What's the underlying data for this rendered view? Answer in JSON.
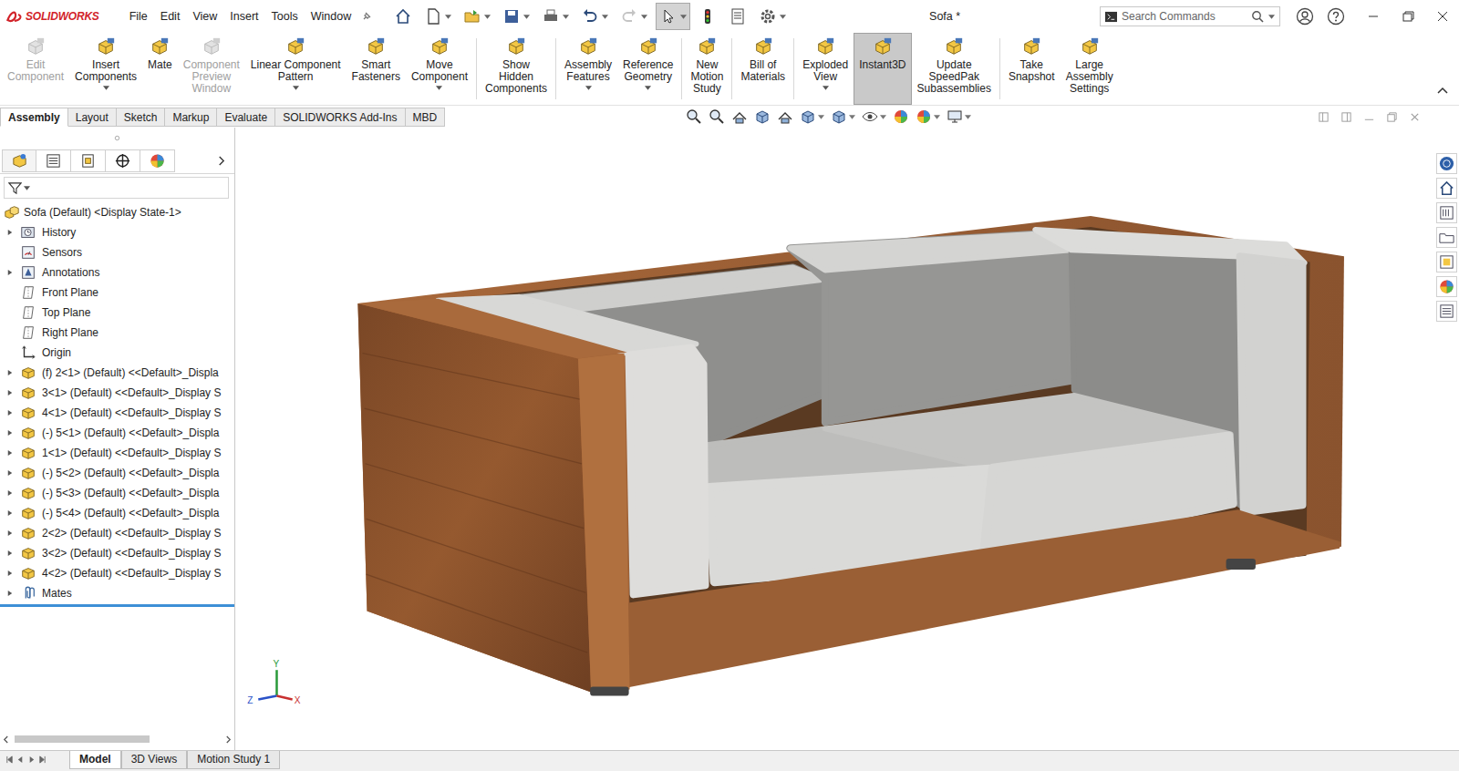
{
  "app": {
    "logo": "SOLIDWORKS",
    "title": "Sofa *"
  },
  "menu": [
    "File",
    "Edit",
    "View",
    "Insert",
    "Tools",
    "Window"
  ],
  "quick_access": {
    "select_active": true,
    "redo_disabled": true
  },
  "search": {
    "placeholder": "Search Commands"
  },
  "ribbon": {
    "groups": [
      [
        {
          "lines": [
            "Edit",
            "Component"
          ],
          "disabled": true,
          "menu": false,
          "selected": false
        },
        {
          "lines": [
            "Insert",
            "Components"
          ],
          "disabled": false,
          "menu": true,
          "selected": false
        },
        {
          "lines": [
            "Mate"
          ],
          "disabled": false,
          "menu": false,
          "selected": false
        },
        {
          "lines": [
            "Component",
            "Preview",
            "Window"
          ],
          "disabled": true,
          "menu": false,
          "selected": false
        },
        {
          "lines": [
            "Linear Component",
            "Pattern"
          ],
          "disabled": false,
          "menu": true,
          "selected": false
        },
        {
          "lines": [
            "Smart",
            "Fasteners"
          ],
          "disabled": false,
          "menu": false,
          "selected": false
        },
        {
          "lines": [
            "Move",
            "Component"
          ],
          "disabled": false,
          "menu": true,
          "selected": false
        }
      ],
      [
        {
          "lines": [
            "Show",
            "Hidden",
            "Components"
          ],
          "disabled": false,
          "menu": false,
          "selected": false
        }
      ],
      [
        {
          "lines": [
            "Assembly",
            "Features"
          ],
          "disabled": false,
          "menu": true,
          "selected": false
        },
        {
          "lines": [
            "Reference",
            "Geometry"
          ],
          "disabled": false,
          "menu": true,
          "selected": false
        }
      ],
      [
        {
          "lines": [
            "New",
            "Motion",
            "Study"
          ],
          "disabled": false,
          "menu": false,
          "selected": false
        }
      ],
      [
        {
          "lines": [
            "Bill of",
            "Materials"
          ],
          "disabled": false,
          "menu": false,
          "selected": false
        }
      ],
      [
        {
          "lines": [
            "Exploded",
            "View"
          ],
          "disabled": false,
          "menu": true,
          "selected": false
        },
        {
          "lines": [
            "Instant3D"
          ],
          "disabled": false,
          "menu": false,
          "selected": true
        },
        {
          "lines": [
            "Update",
            "SpeedPak",
            "Subassemblies"
          ],
          "disabled": false,
          "menu": false,
          "selected": false
        }
      ],
      [
        {
          "lines": [
            "Take",
            "Snapshot"
          ],
          "disabled": false,
          "menu": false,
          "selected": false
        },
        {
          "lines": [
            "Large",
            "Assembly",
            "Settings"
          ],
          "disabled": false,
          "menu": false,
          "selected": false
        }
      ]
    ]
  },
  "command_tabs": [
    {
      "label": "Assembly",
      "selected": true
    },
    {
      "label": "Layout",
      "selected": false
    },
    {
      "label": "Sketch",
      "selected": false
    },
    {
      "label": "Markup",
      "selected": false
    },
    {
      "label": "Evaluate",
      "selected": false
    },
    {
      "label": "SOLIDWORKS Add-Ins",
      "selected": false
    },
    {
      "label": "MBD",
      "selected": false
    }
  ],
  "feature_tree": {
    "items": [
      {
        "label": "Sofa (Default) <Display State-1>",
        "kind": "assembly",
        "root": true,
        "expandable": false,
        "expanded": false
      },
      {
        "label": "History",
        "kind": "history",
        "root": false,
        "expandable": true,
        "expanded": false
      },
      {
        "label": "Sensors",
        "kind": "sensor",
        "root": false,
        "expandable": false,
        "expanded": false
      },
      {
        "label": "Annotations",
        "kind": "annotation",
        "root": false,
        "expandable": true,
        "expanded": false
      },
      {
        "label": "Front Plane",
        "kind": "plane",
        "root": false,
        "expandable": false,
        "expanded": false
      },
      {
        "label": "Top Plane",
        "kind": "plane",
        "root": false,
        "expandable": false,
        "expanded": false
      },
      {
        "label": "Right Plane",
        "kind": "plane",
        "root": false,
        "expandable": false,
        "expanded": false
      },
      {
        "label": "Origin",
        "kind": "origin",
        "root": false,
        "expandable": false,
        "expanded": false
      },
      {
        "label": "(f) 2<1> (Default) <<Default>_Displa",
        "kind": "part",
        "root": false,
        "expandable": true,
        "expanded": false
      },
      {
        "label": "3<1> (Default) <<Default>_Display S",
        "kind": "part",
        "root": false,
        "expandable": true,
        "expanded": false
      },
      {
        "label": "4<1> (Default) <<Default>_Display S",
        "kind": "part",
        "root": false,
        "expandable": true,
        "expanded": false
      },
      {
        "label": "(-) 5<1> (Default) <<Default>_Displa",
        "kind": "part",
        "root": false,
        "expandable": true,
        "expanded": false
      },
      {
        "label": "1<1> (Default) <<Default>_Display S",
        "kind": "part",
        "root": false,
        "expandable": true,
        "expanded": false
      },
      {
        "label": "(-) 5<2> (Default) <<Default>_Displa",
        "kind": "part",
        "root": false,
        "expandable": true,
        "expanded": false
      },
      {
        "label": "(-) 5<3> (Default) <<Default>_Displa",
        "kind": "part",
        "root": false,
        "expandable": true,
        "expanded": false
      },
      {
        "label": "(-) 5<4> (Default) <<Default>_Displa",
        "kind": "part",
        "root": false,
        "expandable": true,
        "expanded": false
      },
      {
        "label": "2<2> (Default) <<Default>_Display S",
        "kind": "part",
        "root": false,
        "expandable": true,
        "expanded": false
      },
      {
        "label": "3<2> (Default) <<Default>_Display S",
        "kind": "part",
        "root": false,
        "expandable": true,
        "expanded": false
      },
      {
        "label": "4<2> (Default) <<Default>_Display S",
        "kind": "part",
        "root": false,
        "expandable": true,
        "expanded": false
      },
      {
        "label": "Mates",
        "kind": "mates",
        "root": false,
        "expandable": true,
        "expanded": false
      }
    ]
  },
  "triad": {
    "y": "Y",
    "z": "Z",
    "x": "X"
  },
  "bottom_tabs": [
    {
      "label": "Model",
      "selected": true
    },
    {
      "label": "3D Views",
      "selected": false
    },
    {
      "label": "Motion Study 1",
      "selected": false
    }
  ]
}
